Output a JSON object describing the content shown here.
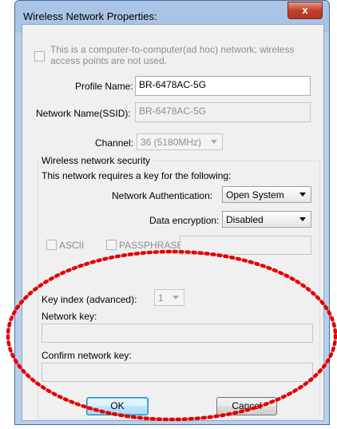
{
  "window": {
    "title": "Wireless Network Properties:",
    "close_label": "x"
  },
  "adhoc": {
    "label_line1": "This is a computer-to-computer(ad hoc) network; wireless",
    "label_line2": "access points are not used.",
    "checked": false
  },
  "profile": {
    "label": "Profile Name:",
    "value": "BR-6478AC-5G"
  },
  "ssid": {
    "label": "Network Name(SSID):",
    "value": "BR-6478AC-5G"
  },
  "channel": {
    "label": "Channel:",
    "value": "36 (5180MHz)"
  },
  "security": {
    "group_label": "Wireless network security",
    "intro": "This network requires a key for the following:",
    "auth_label": "Network Authentication:",
    "auth_value": "Open System",
    "enc_label": "Data encryption:",
    "enc_value": "Disabled",
    "ascii_label": "ASCII",
    "passphrase_label": "PASSPHRASE",
    "key_index_label": "Key index (advanced):",
    "key_index_value": "1",
    "network_key_label": "Network key:",
    "confirm_key_label": "Confirm network key:"
  },
  "buttons": {
    "ok": "OK",
    "cancel": "Cancel"
  },
  "highlight": {
    "color": "#e30000",
    "style": "dotted-ellipse"
  }
}
